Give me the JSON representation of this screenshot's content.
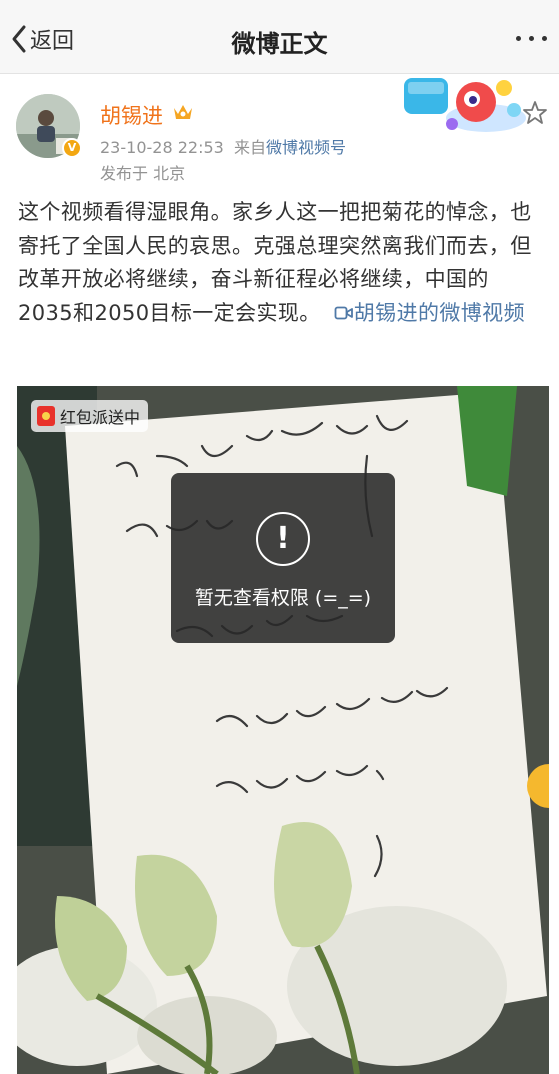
{
  "navbar": {
    "back_label": "返回",
    "title": "微博正文"
  },
  "author": {
    "name": "胡锡进",
    "time": "23-10-28 22:53",
    "source_prefix": "来自",
    "source": "微博视频号",
    "location": "发布于 北京"
  },
  "post": {
    "text": "这个视频看得湿眼角。家乡人这一把把菊花的悼念，也寄托了全国人民的哀思。克强总理突然离我们而去，但改革开放必将继续，奋斗新征程必将继续，中国的2035和2050目标一定会实现。",
    "video_link": "胡锡进的微博视频"
  },
  "video": {
    "badge": "红包派送中",
    "toast": "暂无查看权限 (=_=)"
  },
  "colors": {
    "accent": "#f0731b",
    "link": "#4f79a7",
    "meta": "#939393"
  }
}
